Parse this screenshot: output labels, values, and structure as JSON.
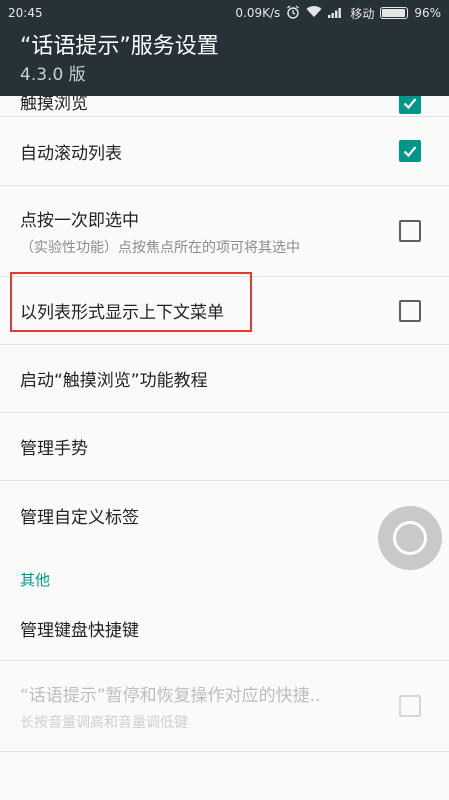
{
  "status_bar": {
    "time": "20:45",
    "network_speed": "0.09K/s",
    "carrier": "移动",
    "battery_text": "96%",
    "battery_level": 0.96
  },
  "app_bar": {
    "title": "“话语提示”服务设置",
    "version": "4.3.0 版"
  },
  "settings": {
    "touch_explore": {
      "title": "触摸浏览",
      "checked": true
    },
    "auto_scroll": {
      "title": "自动滚动列表",
      "checked": true
    },
    "single_tap": {
      "title": "点按一次即选中",
      "summary": "（实验性功能）点按焦点所在的项可将其选中",
      "checked": false
    },
    "context_menu_list": {
      "title": "以列表形式显示上下文菜单",
      "checked": false
    },
    "tutorial": {
      "title": "启动“触摸浏览”功能教程"
    },
    "manage_gestures": {
      "title": "管理手势"
    },
    "manage_labels": {
      "title": "管理自定义标签"
    }
  },
  "other_section": {
    "header": "其他",
    "keyboard_shortcuts": {
      "title": "管理键盘快捷键"
    },
    "pause_shortcut": {
      "title": "“话语提示”暂停和恢复操作对应的快捷..",
      "summary": "长按音量调高和音量调低键",
      "checked": false,
      "enabled": false
    }
  },
  "colors": {
    "accent": "#009688",
    "toolbar": "#263238",
    "highlight": "#e53935"
  }
}
